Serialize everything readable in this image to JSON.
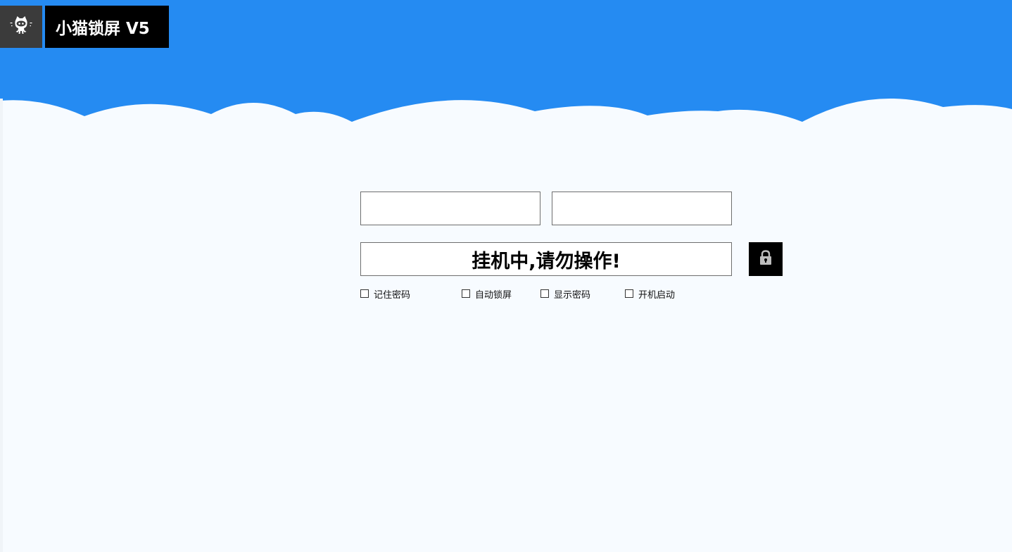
{
  "header": {
    "logo_icon": "octocat-icon",
    "title": "小猫锁屏 V5"
  },
  "form": {
    "field_1_value": "",
    "field_2_value": "",
    "status_text": "挂机中,请勿操作!",
    "lock_icon": "lock-icon"
  },
  "options": {
    "remember_password": {
      "label": "记住密码",
      "checked": false
    },
    "auto_lock": {
      "label": "自动锁屏",
      "checked": false
    },
    "show_password": {
      "label": "显示密码",
      "checked": false
    },
    "start_on_boot": {
      "label": "开机启动",
      "checked": false
    }
  },
  "colors": {
    "sky": "#258BF2",
    "cloud": "#F7FBFF",
    "logo_bg": "#3B3B3B",
    "title_bg": "#000000",
    "lock_bg": "#000000"
  }
}
